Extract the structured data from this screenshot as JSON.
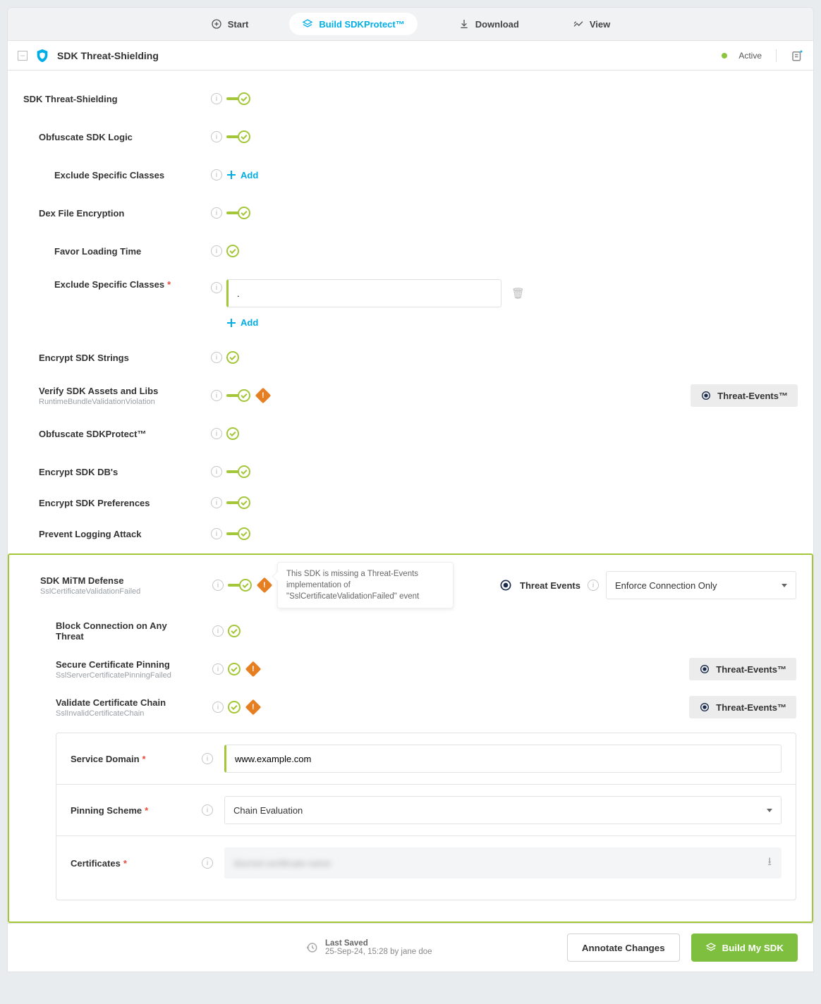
{
  "nav": {
    "start": "Start",
    "build": "Build SDKProtect™",
    "download": "Download",
    "view": "View"
  },
  "header": {
    "title": "SDK Threat-Shielding",
    "status": "Active"
  },
  "threat_events_label": "Threat-Events™",
  "add_label": "Add",
  "rows": {
    "root": {
      "label": "SDK Threat-Shielding"
    },
    "obfuscate": {
      "label": "Obfuscate SDK Logic"
    },
    "obf_exclude": {
      "label": "Exclude Specific Classes"
    },
    "dex": {
      "label": "Dex File Encryption"
    },
    "favor": {
      "label": "Favor Loading Time"
    },
    "dex_exclude": {
      "label": "Exclude Specific Classes",
      "value": "."
    },
    "enc_strings": {
      "label": "Encrypt SDK Strings"
    },
    "verify": {
      "label": "Verify SDK Assets and Libs",
      "sub": "RuntimeBundleValidationViolation"
    },
    "obf_protect": {
      "label": "Obfuscate SDKProtect™"
    },
    "enc_db": {
      "label": "Encrypt SDK DB's"
    },
    "enc_pref": {
      "label": "Encrypt SDK Preferences"
    },
    "prevent_log": {
      "label": "Prevent Logging Attack"
    },
    "mitm": {
      "label": "SDK MiTM Defense",
      "sub": "SslCertificateValidationFailed"
    },
    "block_any": {
      "label": "Block Connection on Any Threat"
    },
    "pinning": {
      "label": "Secure Certificate Pinning",
      "sub": "SslServerCertificatePinningFailed"
    },
    "validate_chain": {
      "label": "Validate Certificate Chain",
      "sub": "SslInvalidCertificateChain"
    }
  },
  "tooltip": "This SDK is missing a Threat-Events implementation of \"SslCertificateValidationFailed\" event",
  "te_inline": {
    "label": "Threat Events",
    "selected": "Enforce Connection Only"
  },
  "card": {
    "service_domain": {
      "label": "Service Domain",
      "value": "www.example.com"
    },
    "pinning_scheme": {
      "label": "Pinning Scheme",
      "value": "Chain Evaluation"
    },
    "certificates": {
      "label": "Certificates",
      "placeholder": "blurred-certificate-name"
    }
  },
  "footer": {
    "last_saved_title": "Last Saved",
    "last_saved_sub": "25-Sep-24, 15:28 by jane doe",
    "annotate": "Annotate Changes",
    "build": "Build My SDK"
  }
}
